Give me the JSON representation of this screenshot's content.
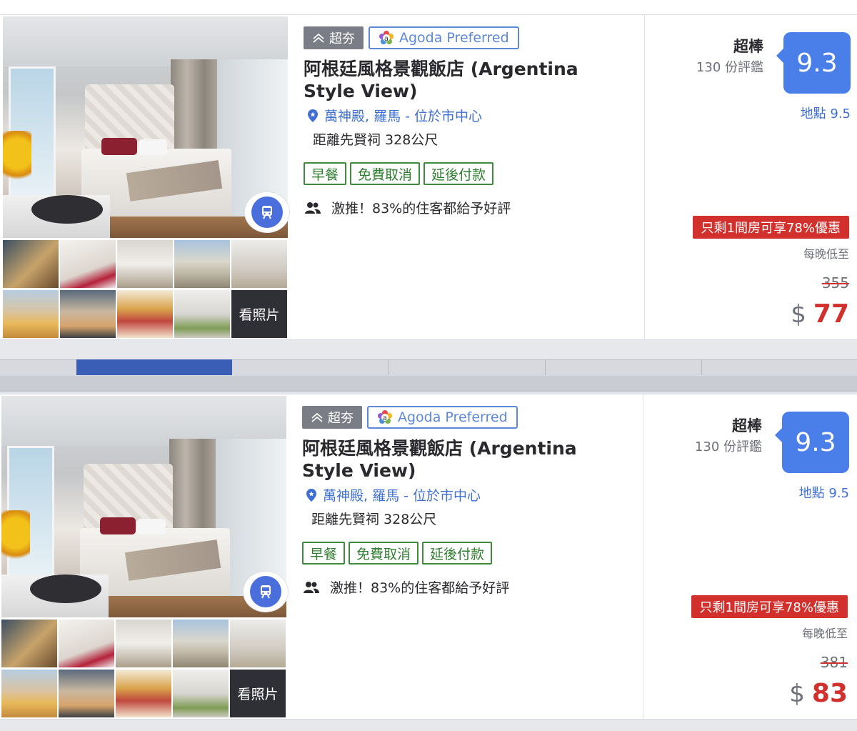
{
  "cards": [
    {
      "luxury_tag": "超夯",
      "agoda_tag": "Agoda Preferred",
      "hotel_name": "阿根廷風格景觀飯店 (Argentina Style View)",
      "location": "萬神殿, 羅馬 - 位於市中心",
      "distance": "距離先賢祠 328公尺",
      "features": [
        "早餐",
        "免費取消",
        "延後付款"
      ],
      "recommendation": "激推！83%的住客都給予好評",
      "see_photos": "看照片",
      "rating_word": "超棒",
      "review_count": "130 份評鑑",
      "score": "9.3",
      "location_score": "地點 9.5",
      "deal": "只剩1間房可享78%優惠",
      "per_night": "每晚低至",
      "old_price": "355",
      "currency": "$",
      "price": "77"
    },
    {
      "luxury_tag": "超夯",
      "agoda_tag": "Agoda Preferred",
      "hotel_name": "阿根廷風格景觀飯店 (Argentina Style View)",
      "location": "萬神殿, 羅馬 - 位於市中心",
      "distance": "距離先賢祠 328公尺",
      "features": [
        "早餐",
        "免費取消",
        "延後付款"
      ],
      "recommendation": "激推！83%的住客都給予好評",
      "see_photos": "看照片",
      "rating_word": "超棒",
      "review_count": "130 份評鑑",
      "score": "9.3",
      "location_score": "地點 9.5",
      "deal": "只剩1間房可享78%優惠",
      "per_night": "每晚低至",
      "old_price": "381",
      "currency": "$",
      "price": "83"
    }
  ],
  "colors": {
    "accent_blue": "#4a7ee8",
    "deal_red": "#d1302c",
    "feature_green": "#2f7d2f"
  }
}
